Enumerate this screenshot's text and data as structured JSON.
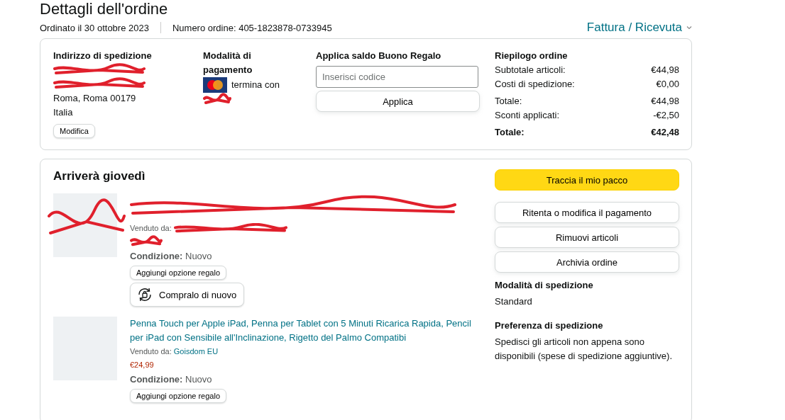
{
  "page_title": "Dettagli dell'ordine",
  "order_meta": {
    "date": "Ordinato il 30 ottobre 2023",
    "number": "Numero ordine: 405-1823878-0733945"
  },
  "invoice_link": "Fattura / Ricevuta",
  "shipping_address": {
    "heading": "Indirizzo di spedizione",
    "lines": [
      {
        "redacted": true
      },
      {
        "redacted": true
      },
      {
        "text": "Roma, Roma 00179",
        "redacted": false
      },
      {
        "text": "Italia",
        "redacted": false
      }
    ],
    "edit_button": "Modifica"
  },
  "payment": {
    "heading": "Modalità di pagamento",
    "card_text": "termina con",
    "card_number_redacted": true
  },
  "gift_card": {
    "heading": "Applica saldo Buono Regalo",
    "placeholder": "Inserisci codice",
    "button": "Applica"
  },
  "summary": {
    "heading": "Riepilogo ordine",
    "rows": [
      {
        "label": "Subtotale articoli:",
        "value": "€44,98",
        "bold": false
      },
      {
        "label": "Costi di spedizione:",
        "value": "€0,00",
        "bold": false
      },
      {
        "label": "Totale:",
        "value": "€44,98",
        "bold": false
      },
      {
        "label": "Sconti applicati:",
        "value": "-€2,50",
        "bold": false
      },
      {
        "label": "Totale:",
        "value": "€42,48",
        "bold": true
      }
    ]
  },
  "delivery": {
    "heading": "Arriverà giovedì",
    "items": [
      {
        "image_redacted": true,
        "title_redacted": true,
        "seller_label": "Venduto da:",
        "seller_redacted": true,
        "price_redacted": true,
        "condition": "**Condizione:** Nuovo",
        "gift_button": "Aggiungi opzione regalo",
        "buy_again": "Compralo di nuovo"
      },
      {
        "image_redacted": false,
        "title_redacted": false,
        "seller_redacted": false,
        "price_redacted": false,
        "title": "Penna Touch per Apple iPad, Penna per Tablet con 5 Minuti Ricarica Rapida, Pencil per iPad con Sensibile all'Inclinazione, Rigetto del Palmo Compatibi",
        "seller_label": "Venduto da:",
        "seller": "Goisdom EU",
        "price": "€24,99",
        "condition": "**Condizione:** Nuovo",
        "gift_button": "Aggiungi opzione regalo"
      }
    ]
  },
  "actions": [
    {
      "label": "Traccia il mio pacco",
      "kind": "primary"
    },
    {
      "label": "Ritenta o modifica il pagamento",
      "kind": "secondary"
    },
    {
      "label": "Rimuovi articoli",
      "kind": "secondary"
    },
    {
      "label": "Archivia ordine",
      "kind": "secondary"
    }
  ],
  "shipping_method": {
    "heading": "Modalità di spedizione",
    "value": "Standard"
  },
  "shipping_preference": {
    "heading": "Preferenza di spedizione",
    "value": "Spedisci gli articoli non appena sono disponibili (spese di spedizione aggiuntive)."
  }
}
